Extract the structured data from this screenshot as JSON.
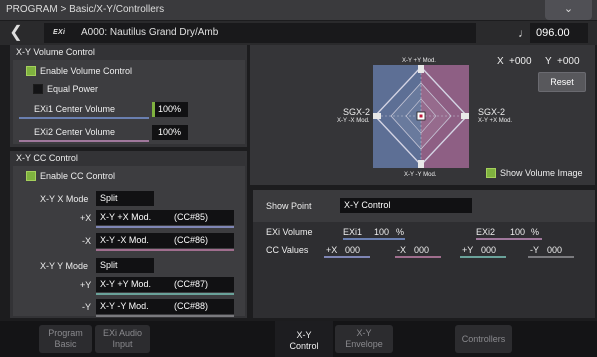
{
  "header": {
    "breadcrumb": "PROGRAM > Basic/X-Y/Controllers",
    "menu_icon": "chevron-down-icon"
  },
  "program": {
    "exi_badge": "EXi",
    "name": "A000: Nautilus Grand Dry/Amb",
    "tempo": "096.00"
  },
  "volume_control": {
    "title": "X-Y Volume Control",
    "enable_label": "Enable Volume Control",
    "enabled": true,
    "equal_power_label": "Equal Power",
    "equal_power": false,
    "exi1_label": "EXi1 Center Volume",
    "exi1_value": "100%",
    "exi1_level": 1.0,
    "exi2_label": "EXi2 Center Volume",
    "exi2_value": "100%"
  },
  "cc_control": {
    "title": "X-Y CC Control",
    "enable_label": "Enable CC Control",
    "enabled": true,
    "x_mode_label": "X-Y X Mode",
    "x_mode_value": "Split",
    "plus_x_label": "+X",
    "plus_x_name": "X-Y +X Mod.",
    "plus_x_cc": "(CC#85)",
    "minus_x_label": "-X",
    "minus_x_name": "X-Y -X Mod.",
    "minus_x_cc": "(CC#86)",
    "y_mode_label": "X-Y Y Mode",
    "y_mode_value": "Split",
    "plus_y_label": "+Y",
    "plus_y_name": "X-Y +Y Mod.",
    "plus_y_cc": "(CC#87)",
    "minus_y_label": "-Y",
    "minus_y_name": "X-Y -Y Mod.",
    "minus_y_cc": "(CC#88)"
  },
  "xy_pad": {
    "top_label": "X-Y +Y Mod.",
    "bottom_label": "X-Y -Y Mod.",
    "left_label_1": "SGX-2",
    "left_label_2": "X-Y -X Mod.",
    "right_label_1": "SGX-2",
    "right_label_2": "X-Y +X Mod.",
    "x_label": "X",
    "x_value": "+000",
    "y_label": "Y",
    "y_value": "+000",
    "reset_label": "Reset",
    "show_volume_label": "Show Volume Image",
    "show_volume": true,
    "colors": {
      "left": "#5d6f95",
      "right": "#8e5f84",
      "grid": "#c8c8d8"
    }
  },
  "info": {
    "show_point_label": "Show Point",
    "show_point_value": "X-Y Control",
    "exi_volume_label": "EXi Volume",
    "exi1_label": "EXi1",
    "exi1_value": "100",
    "exi1_unit": "%",
    "exi2_label": "EXi2",
    "exi2_value": "100",
    "exi2_unit": "%",
    "cc_values_label": "CC Values",
    "px_label": "+X",
    "px_value": "000",
    "mx_label": "-X",
    "mx_value": "000",
    "py_label": "+Y",
    "py_value": "000",
    "my_label": "-Y",
    "my_value": "000"
  },
  "tabs": [
    {
      "line1": "Program",
      "line2": "Basic"
    },
    {
      "line1": "EXi Audio",
      "line2": "Input"
    },
    {
      "line1": "X-Y",
      "line2": "Control"
    },
    {
      "line1": "X-Y",
      "line2": "Envelope"
    },
    {
      "line1": "Controllers",
      "line2": ""
    }
  ],
  "active_tab": "X-Y Control"
}
